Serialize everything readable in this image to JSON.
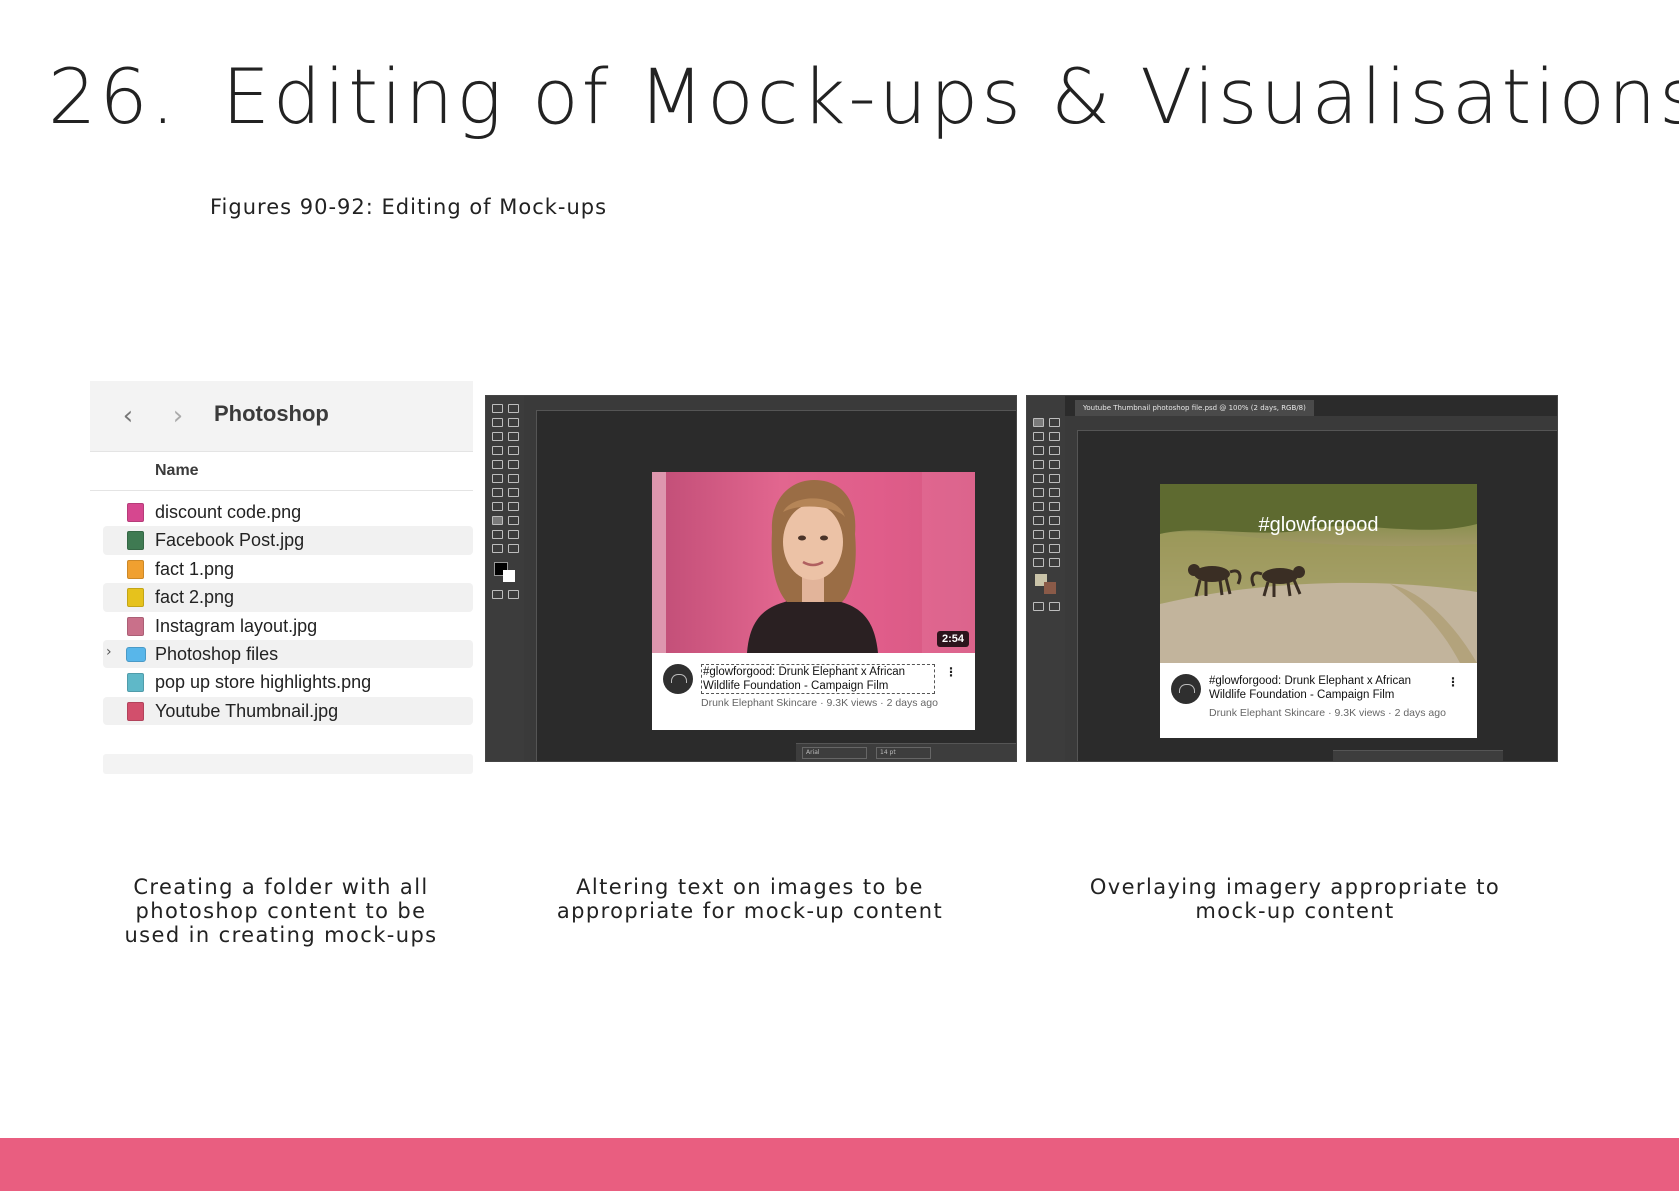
{
  "slide": {
    "number": "26.",
    "title": "Editing of Mock-ups & Visualisations",
    "subtitle": "Figures 90-92: Editing of Mock-ups",
    "accent_color": "#e95e80"
  },
  "finder": {
    "folder_title": "Photoshop",
    "column_header": "Name",
    "back_icon": "chevron-left-icon",
    "forward_icon": "chevron-right-icon",
    "files": [
      {
        "name": "discount code.png",
        "icon_color": "#d6478f"
      },
      {
        "name": "Facebook Post.jpg",
        "icon_color": "#3f7a52"
      },
      {
        "name": "fact 1.png",
        "icon_color": "#f0a030"
      },
      {
        "name": "fact 2.png",
        "icon_color": "#e6c21c"
      },
      {
        "name": "Instagram layout.jpg",
        "icon_color": "#c9708a"
      },
      {
        "name": "Photoshop files",
        "icon_color": "#58b6ea"
      },
      {
        "name": "pop up store highlights.png",
        "icon_color": "#5fb8c8"
      },
      {
        "name": "Youtube Thumbnail.jpg",
        "icon_color": "#d24f6c"
      }
    ]
  },
  "ps_one": {
    "duration": "2:54",
    "video_title": "#glowforgood: Drunk Elephant x African Wildlife Foundation - Campaign Film",
    "video_meta": "Drunk Elephant Skincare · 9.3K views · 2 days ago",
    "options_font": "Arial",
    "options_size": "14 pt"
  },
  "ps_two": {
    "document_tab": "Youtube Thumbnail photoshop file.psd @ 100% (2 days, RGB/8)",
    "overlay_hashtag": "#glowforgood",
    "video_title": "#glowforgood: Drunk Elephant x African Wildlife Foundation - Campaign Film",
    "video_meta": "Drunk Elephant Skincare · 9.3K views · 2 days ago"
  },
  "captions": {
    "one": "Creating a folder with all photoshop content to be used in creating mock-ups",
    "two": "Altering text on images to be appropriate for mock-up content",
    "three": "Overlaying imagery appropriate to mock-up content"
  }
}
